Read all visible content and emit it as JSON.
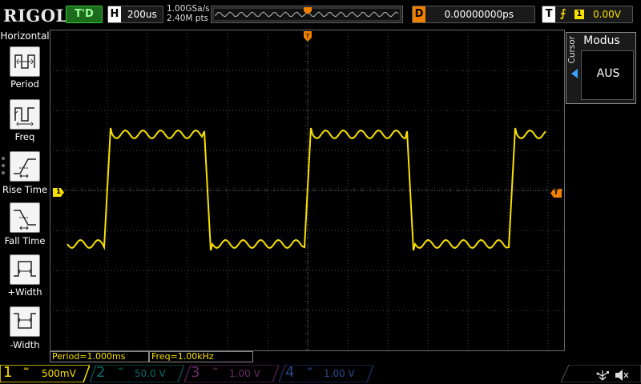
{
  "brand": "RIGOL",
  "run_status": "T'D",
  "horizontal": {
    "tag": "H",
    "timebase": "200us"
  },
  "acquisition": {
    "sample_rate": "1.00GSa/s",
    "memory_depth": "2.40M pts"
  },
  "delay": {
    "tag": "D",
    "value": "0.00000000ps"
  },
  "trigger": {
    "tag": "T",
    "edge_symbol": "⨍",
    "source": "1",
    "level": "0.00V"
  },
  "left_menu": {
    "title": "Horizontal",
    "items": [
      {
        "label": "Period",
        "icon": "period-icon"
      },
      {
        "label": "Freq",
        "icon": "frequency-icon"
      },
      {
        "label": "Rise Time",
        "icon": "rise-time-icon"
      },
      {
        "label": "Fall Time",
        "icon": "fall-time-icon"
      },
      {
        "label": "+Width",
        "icon": "positive-width-icon"
      },
      {
        "label": "-Width",
        "icon": "negative-width-icon"
      }
    ]
  },
  "right_panel": {
    "title": "Modus",
    "side_label": "Cursor",
    "value": "AUS"
  },
  "channel1_marker": "1",
  "trigger_marker": "T",
  "measurements": {
    "period": "Period=1.000ms",
    "freq": "Freq=1.00kHz"
  },
  "channels": [
    {
      "num": "1",
      "coupling": "═",
      "scale": "500mV",
      "color": "#f8e000",
      "active": true
    },
    {
      "num": "2",
      "coupling": "═",
      "scale": "50.0 V",
      "color": "#00c8c8",
      "active": false
    },
    {
      "num": "3",
      "coupling": "═",
      "scale": "1.00 V",
      "color": "#e040e0",
      "active": false
    },
    {
      "num": "4",
      "coupling": "═",
      "scale": "1.00 V",
      "color": "#3070ff",
      "active": false
    }
  ],
  "colors": {
    "trace": "#f8e000",
    "grid": "#4a4a4a",
    "trigger": "#f08000",
    "accent": "#3aa0ff"
  }
}
